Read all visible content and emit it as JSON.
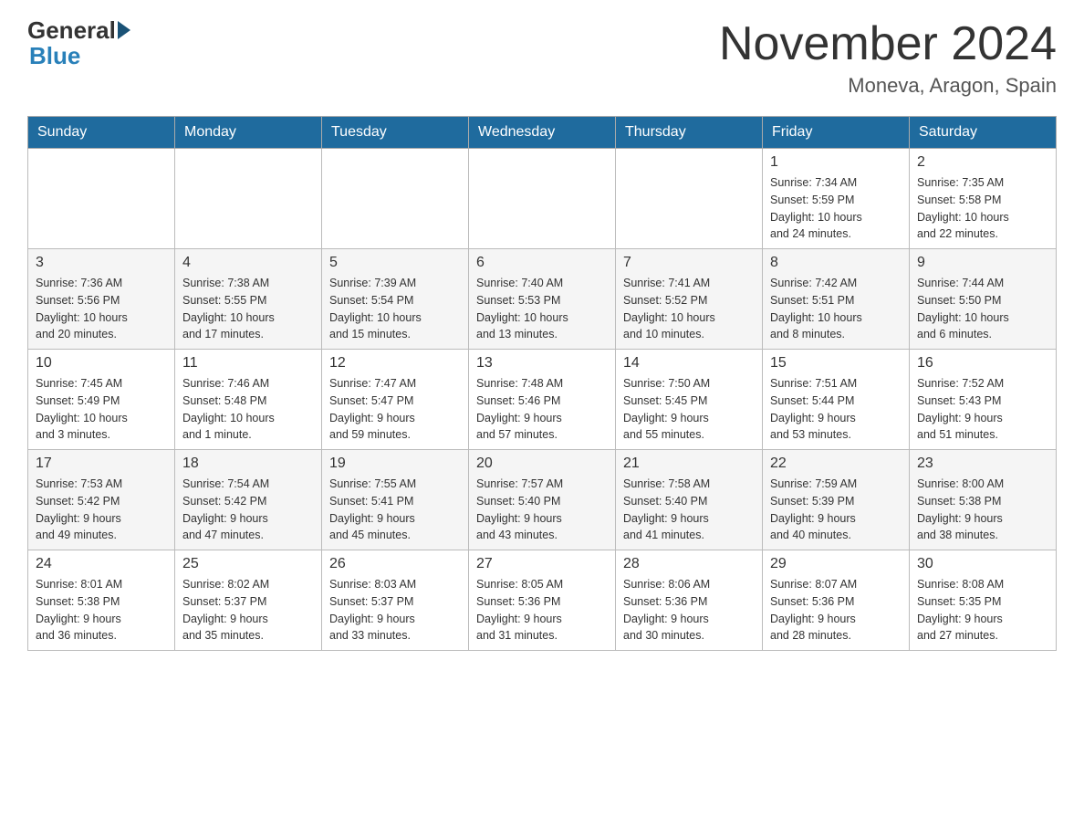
{
  "header": {
    "logo_general": "General",
    "logo_blue": "Blue",
    "title": "November 2024",
    "location": "Moneva, Aragon, Spain"
  },
  "weekdays": [
    "Sunday",
    "Monday",
    "Tuesday",
    "Wednesday",
    "Thursday",
    "Friday",
    "Saturday"
  ],
  "weeks": [
    [
      {
        "day": "",
        "info": ""
      },
      {
        "day": "",
        "info": ""
      },
      {
        "day": "",
        "info": ""
      },
      {
        "day": "",
        "info": ""
      },
      {
        "day": "",
        "info": ""
      },
      {
        "day": "1",
        "info": "Sunrise: 7:34 AM\nSunset: 5:59 PM\nDaylight: 10 hours\nand 24 minutes."
      },
      {
        "day": "2",
        "info": "Sunrise: 7:35 AM\nSunset: 5:58 PM\nDaylight: 10 hours\nand 22 minutes."
      }
    ],
    [
      {
        "day": "3",
        "info": "Sunrise: 7:36 AM\nSunset: 5:56 PM\nDaylight: 10 hours\nand 20 minutes."
      },
      {
        "day": "4",
        "info": "Sunrise: 7:38 AM\nSunset: 5:55 PM\nDaylight: 10 hours\nand 17 minutes."
      },
      {
        "day": "5",
        "info": "Sunrise: 7:39 AM\nSunset: 5:54 PM\nDaylight: 10 hours\nand 15 minutes."
      },
      {
        "day": "6",
        "info": "Sunrise: 7:40 AM\nSunset: 5:53 PM\nDaylight: 10 hours\nand 13 minutes."
      },
      {
        "day": "7",
        "info": "Sunrise: 7:41 AM\nSunset: 5:52 PM\nDaylight: 10 hours\nand 10 minutes."
      },
      {
        "day": "8",
        "info": "Sunrise: 7:42 AM\nSunset: 5:51 PM\nDaylight: 10 hours\nand 8 minutes."
      },
      {
        "day": "9",
        "info": "Sunrise: 7:44 AM\nSunset: 5:50 PM\nDaylight: 10 hours\nand 6 minutes."
      }
    ],
    [
      {
        "day": "10",
        "info": "Sunrise: 7:45 AM\nSunset: 5:49 PM\nDaylight: 10 hours\nand 3 minutes."
      },
      {
        "day": "11",
        "info": "Sunrise: 7:46 AM\nSunset: 5:48 PM\nDaylight: 10 hours\nand 1 minute."
      },
      {
        "day": "12",
        "info": "Sunrise: 7:47 AM\nSunset: 5:47 PM\nDaylight: 9 hours\nand 59 minutes."
      },
      {
        "day": "13",
        "info": "Sunrise: 7:48 AM\nSunset: 5:46 PM\nDaylight: 9 hours\nand 57 minutes."
      },
      {
        "day": "14",
        "info": "Sunrise: 7:50 AM\nSunset: 5:45 PM\nDaylight: 9 hours\nand 55 minutes."
      },
      {
        "day": "15",
        "info": "Sunrise: 7:51 AM\nSunset: 5:44 PM\nDaylight: 9 hours\nand 53 minutes."
      },
      {
        "day": "16",
        "info": "Sunrise: 7:52 AM\nSunset: 5:43 PM\nDaylight: 9 hours\nand 51 minutes."
      }
    ],
    [
      {
        "day": "17",
        "info": "Sunrise: 7:53 AM\nSunset: 5:42 PM\nDaylight: 9 hours\nand 49 minutes."
      },
      {
        "day": "18",
        "info": "Sunrise: 7:54 AM\nSunset: 5:42 PM\nDaylight: 9 hours\nand 47 minutes."
      },
      {
        "day": "19",
        "info": "Sunrise: 7:55 AM\nSunset: 5:41 PM\nDaylight: 9 hours\nand 45 minutes."
      },
      {
        "day": "20",
        "info": "Sunrise: 7:57 AM\nSunset: 5:40 PM\nDaylight: 9 hours\nand 43 minutes."
      },
      {
        "day": "21",
        "info": "Sunrise: 7:58 AM\nSunset: 5:40 PM\nDaylight: 9 hours\nand 41 minutes."
      },
      {
        "day": "22",
        "info": "Sunrise: 7:59 AM\nSunset: 5:39 PM\nDaylight: 9 hours\nand 40 minutes."
      },
      {
        "day": "23",
        "info": "Sunrise: 8:00 AM\nSunset: 5:38 PM\nDaylight: 9 hours\nand 38 minutes."
      }
    ],
    [
      {
        "day": "24",
        "info": "Sunrise: 8:01 AM\nSunset: 5:38 PM\nDaylight: 9 hours\nand 36 minutes."
      },
      {
        "day": "25",
        "info": "Sunrise: 8:02 AM\nSunset: 5:37 PM\nDaylight: 9 hours\nand 35 minutes."
      },
      {
        "day": "26",
        "info": "Sunrise: 8:03 AM\nSunset: 5:37 PM\nDaylight: 9 hours\nand 33 minutes."
      },
      {
        "day": "27",
        "info": "Sunrise: 8:05 AM\nSunset: 5:36 PM\nDaylight: 9 hours\nand 31 minutes."
      },
      {
        "day": "28",
        "info": "Sunrise: 8:06 AM\nSunset: 5:36 PM\nDaylight: 9 hours\nand 30 minutes."
      },
      {
        "day": "29",
        "info": "Sunrise: 8:07 AM\nSunset: 5:36 PM\nDaylight: 9 hours\nand 28 minutes."
      },
      {
        "day": "30",
        "info": "Sunrise: 8:08 AM\nSunset: 5:35 PM\nDaylight: 9 hours\nand 27 minutes."
      }
    ]
  ]
}
